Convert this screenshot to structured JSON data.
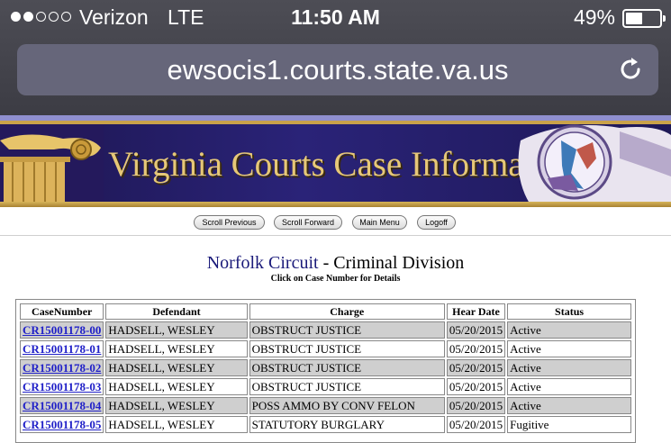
{
  "status_bar": {
    "carrier": "Verizon",
    "network": "LTE",
    "time": "11:50 AM",
    "battery": "49%",
    "signal_filled": 2,
    "signal_total": 5
  },
  "browser": {
    "url": "ewsocis1.courts.state.va.us",
    "reload_icon": "reload-icon"
  },
  "banner": {
    "title": "Virginia Courts Case Information"
  },
  "nav_buttons": {
    "scroll_previous": "Scroll Previous",
    "scroll_forward": "Scroll Forward",
    "main_menu": "Main Menu",
    "logoff": "Logoff"
  },
  "page": {
    "court": "Norfolk Circuit",
    "separator": " - ",
    "division": "Criminal Division",
    "instruction": "Click on Case Number for Details"
  },
  "table": {
    "headers": [
      "CaseNumber",
      "Defendant",
      "Charge",
      "Hear Date",
      "Status"
    ],
    "rows": [
      {
        "case": "CR15001178-00",
        "defendant": "HADSELL, WESLEY",
        "charge": "OBSTRUCT JUSTICE",
        "date": "05/20/2015",
        "status": "Active"
      },
      {
        "case": "CR15001178-01",
        "defendant": "HADSELL, WESLEY",
        "charge": "OBSTRUCT JUSTICE",
        "date": "05/20/2015",
        "status": "Active"
      },
      {
        "case": "CR15001178-02",
        "defendant": "HADSELL, WESLEY",
        "charge": "OBSTRUCT JUSTICE",
        "date": "05/20/2015",
        "status": "Active"
      },
      {
        "case": "CR15001178-03",
        "defendant": "HADSELL, WESLEY",
        "charge": "OBSTRUCT JUSTICE",
        "date": "05/20/2015",
        "status": "Active"
      },
      {
        "case": "CR15001178-04",
        "defendant": "HADSELL, WESLEY",
        "charge": "POSS AMMO BY CONV FELON",
        "date": "05/20/2015",
        "status": "Active"
      },
      {
        "case": "CR15001178-05",
        "defendant": "HADSELL, WESLEY",
        "charge": "STATUTORY BURGLARY",
        "date": "05/20/2015",
        "status": "Fugitive"
      }
    ]
  }
}
